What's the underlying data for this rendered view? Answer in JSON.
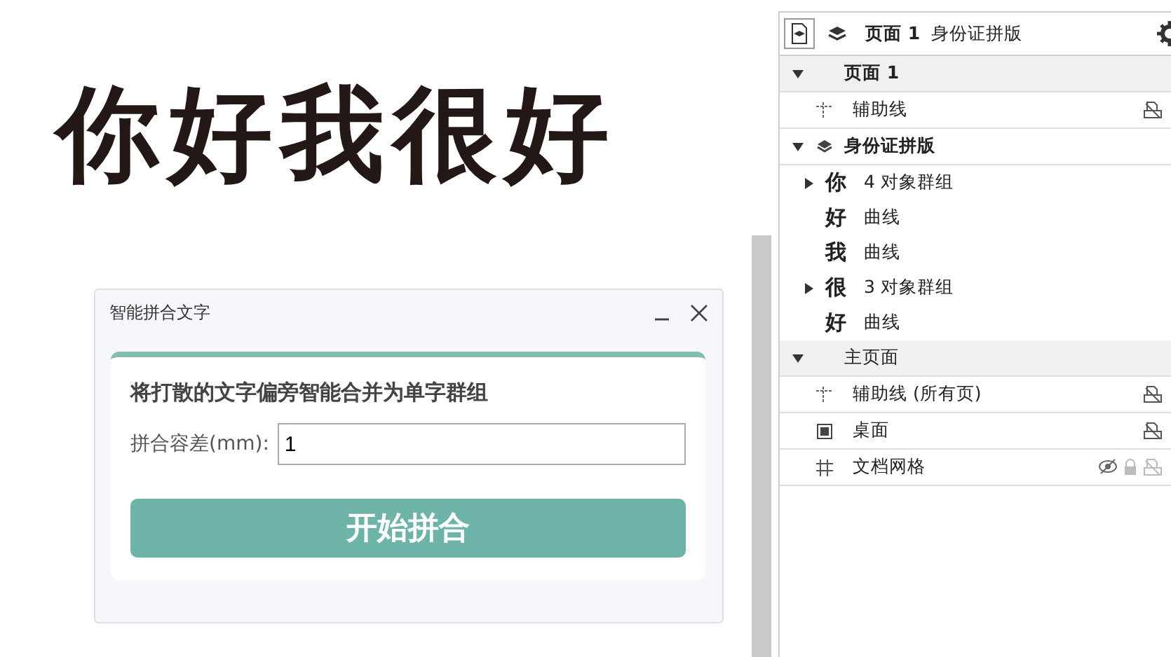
{
  "canvas": {
    "text": "你好我很好"
  },
  "dialog": {
    "title": "智能拼合文字",
    "description": "将打散的文字偏旁智能合并为单字群组",
    "field": {
      "label": "拼合容差(mm):",
      "value": "1"
    },
    "button": "开始拼合"
  },
  "panel": {
    "header": {
      "page": "页面 1",
      "layer": "身份证拼版"
    },
    "items": [
      {
        "kind": "page",
        "label": "页面 1",
        "expanded": true,
        "children": [
          {
            "kind": "guides",
            "label": "辅助线"
          },
          {
            "kind": "layer",
            "label": "身份证拼版",
            "expanded": true,
            "children": [
              {
                "kind": "group",
                "glyph": "你",
                "label": "4 对象群组",
                "expanded": false
              },
              {
                "kind": "curve",
                "glyph": "好",
                "label": "曲线"
              },
              {
                "kind": "curve",
                "glyph": "我",
                "label": "曲线"
              },
              {
                "kind": "group",
                "glyph": "很",
                "label": "3 对象群组",
                "expanded": false
              },
              {
                "kind": "curve",
                "glyph": "好",
                "label": "曲线"
              }
            ]
          }
        ]
      },
      {
        "kind": "master",
        "label": "主页面",
        "expanded": true,
        "children": [
          {
            "kind": "guides",
            "label": "辅助线 (所有页)"
          },
          {
            "kind": "desktop",
            "label": "桌面"
          },
          {
            "kind": "grid",
            "label": "文档网格"
          }
        ]
      }
    ]
  }
}
